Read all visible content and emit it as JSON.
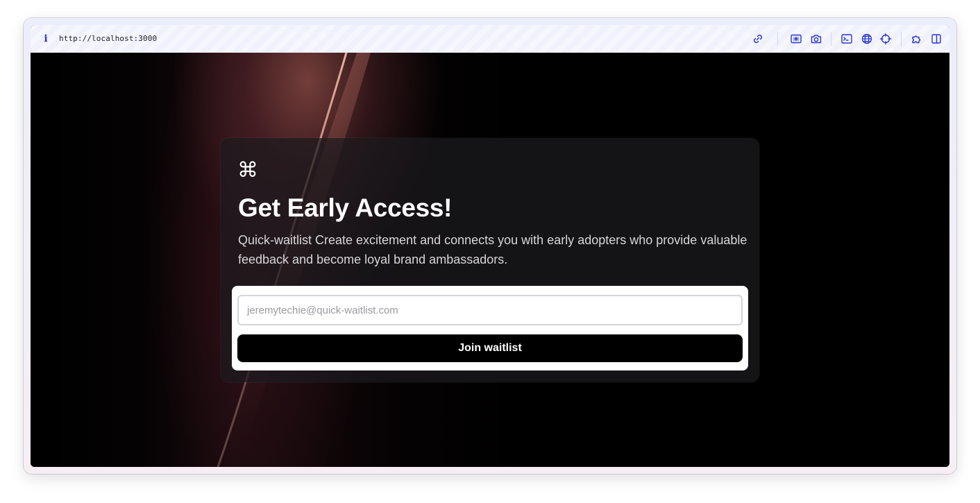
{
  "browser": {
    "url": "http://localhost:3000",
    "info_icon": "info-icon",
    "toolbar_icons": [
      "link-icon",
      "screenshot-region-icon",
      "camera-icon",
      "terminal-icon",
      "globe-icon",
      "crosshair-icon",
      "extension-icon",
      "split-view-icon"
    ],
    "accent_color": "#2a36c8"
  },
  "page": {
    "logo_icon": "command-key-icon",
    "logo_glyph": "⌘",
    "title": "Get Early Access!",
    "description": "Quick-waitlist Create excitement and connects you with early adopters who provide valuable feedback and become loyal brand ambassadors.",
    "form": {
      "email_placeholder": "jeremytechie@quick-waitlist.com",
      "email_value": "",
      "submit_label": "Join waitlist"
    }
  }
}
